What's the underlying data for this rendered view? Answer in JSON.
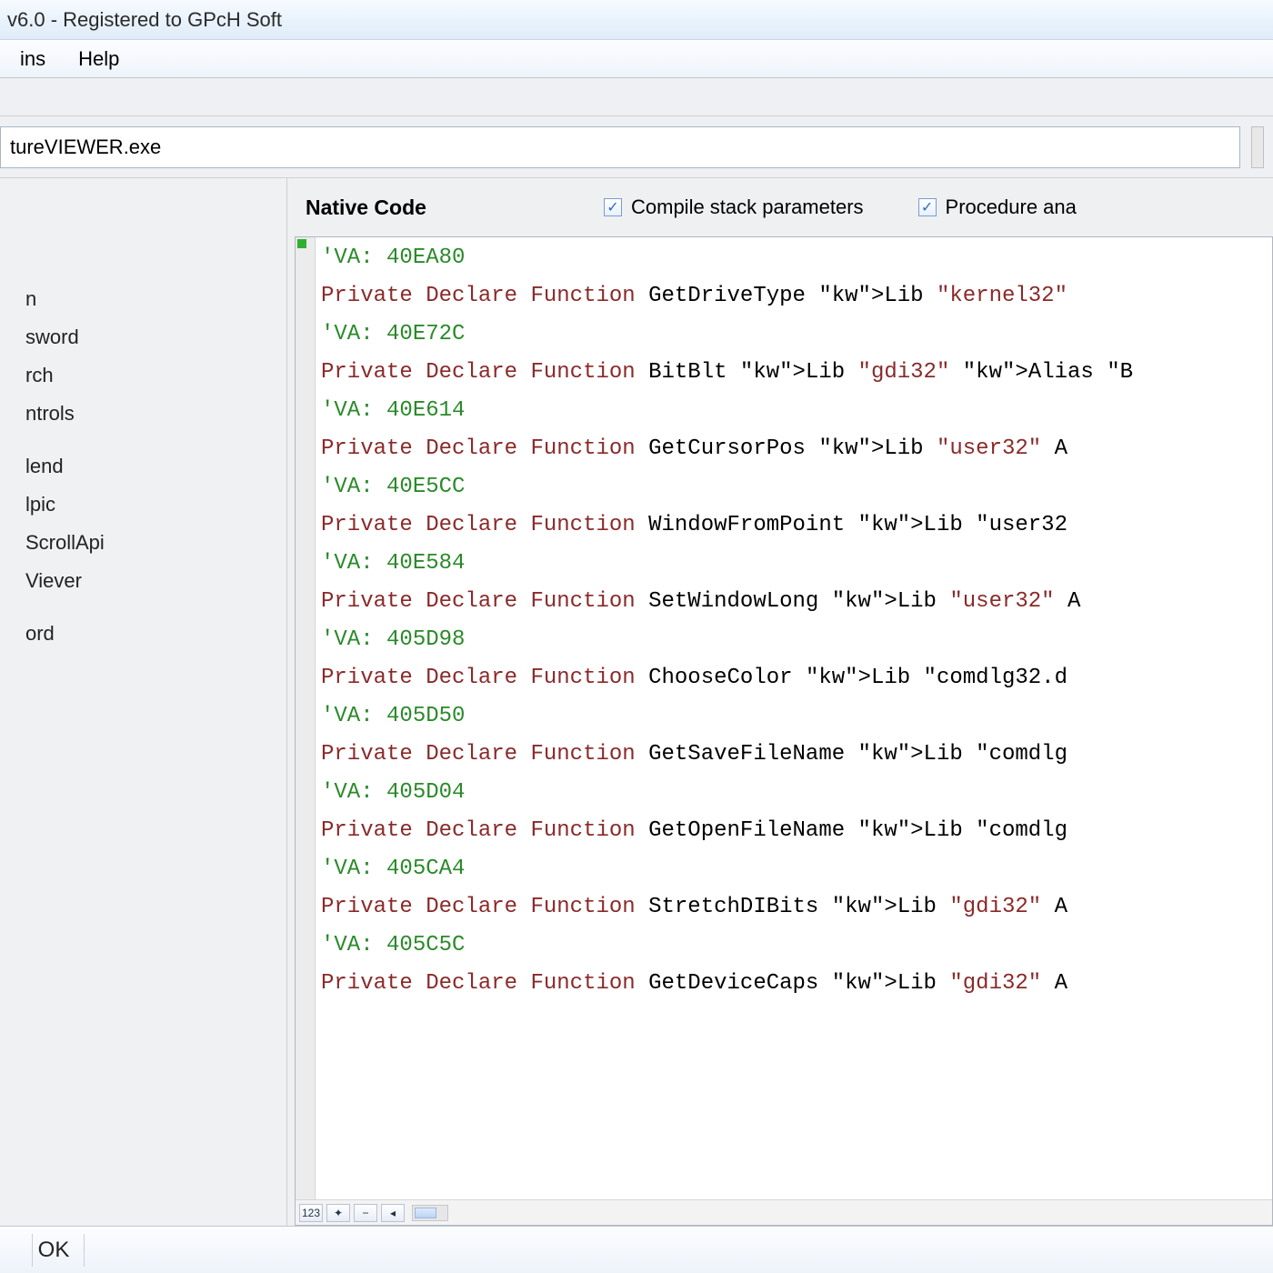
{
  "titlebar": {
    "text": "v6.0 - Registered to GPcH Soft"
  },
  "menu": {
    "items": [
      "ins",
      "Help"
    ]
  },
  "path": {
    "value": "tureVIEWER.exe"
  },
  "left": {
    "nodes": [
      "",
      "",
      "n",
      "sword",
      "rch",
      "ntrols",
      "",
      "lend",
      "lpic",
      "ScrollApi",
      "Viever",
      "",
      "ord"
    ]
  },
  "right": {
    "heading": "Native Code",
    "checks": [
      {
        "label": "Compile stack parameters",
        "checked": true
      },
      {
        "label": "Procedure ana",
        "checked": true
      }
    ]
  },
  "code": {
    "lines": [
      {
        "t": "comment",
        "text": "'VA: 40EA80"
      },
      {
        "t": "decl",
        "fn": "GetDriveType",
        "tail": " Lib \"kernel32\" "
      },
      {
        "t": "comment",
        "text": "'VA: 40E72C"
      },
      {
        "t": "decl",
        "fn": "BitBlt",
        "tail": " Lib \"gdi32\" Alias \"B"
      },
      {
        "t": "comment",
        "text": "'VA: 40E614"
      },
      {
        "t": "decl",
        "fn": "GetCursorPos",
        "tail": " Lib \"user32\" A"
      },
      {
        "t": "comment",
        "text": "'VA: 40E5CC"
      },
      {
        "t": "decl",
        "fn": "WindowFromPoint",
        "tail": " Lib \"user32"
      },
      {
        "t": "comment",
        "text": "'VA: 40E584"
      },
      {
        "t": "decl",
        "fn": "SetWindowLong",
        "tail": " Lib \"user32\" A"
      },
      {
        "t": "comment",
        "text": "'VA: 405D98"
      },
      {
        "t": "decl",
        "fn": "ChooseColor",
        "tail": " Lib \"comdlg32.d"
      },
      {
        "t": "comment",
        "text": "'VA: 405D50"
      },
      {
        "t": "decl",
        "fn": "GetSaveFileName",
        "tail": " Lib \"comdlg"
      },
      {
        "t": "comment",
        "text": "'VA: 405D04"
      },
      {
        "t": "decl",
        "fn": "GetOpenFileName",
        "tail": " Lib \"comdlg"
      },
      {
        "t": "comment",
        "text": "'VA: 405CA4"
      },
      {
        "t": "decl",
        "fn": "StretchDIBits",
        "tail": " Lib \"gdi32\" A"
      },
      {
        "t": "comment",
        "text": "'VA: 405C5C"
      },
      {
        "t": "decl",
        "fn": "GetDeviceCaps",
        "tail": " Lib \"gdi32\" A"
      }
    ]
  },
  "gadgets": {
    "a": "123",
    "b": "✦",
    "c": "−",
    "d": "◂"
  },
  "status": {
    "ok": "OK"
  }
}
